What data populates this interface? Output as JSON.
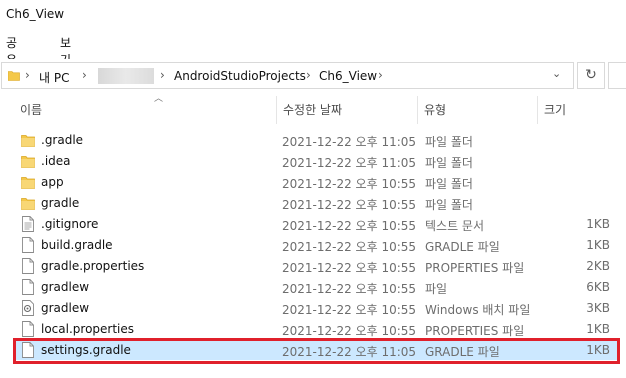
{
  "window": {
    "title": "Ch6_View"
  },
  "ribbon": {
    "share": "공유",
    "view": "보기"
  },
  "address": {
    "this_pc": "내 PC",
    "projects": "AndroidStudioProjects",
    "current": "Ch6_View",
    "refresh_icon": "refresh-icon"
  },
  "columns": {
    "name": "이름",
    "date": "수정한 날짜",
    "type": "유형",
    "size": "크기"
  },
  "files": [
    {
      "name": ".gradle",
      "date": "2021-12-22 오후 11:05",
      "type": "파일 폴더",
      "size": "",
      "icon": "folder"
    },
    {
      "name": ".idea",
      "date": "2021-12-22 오후 11:05",
      "type": "파일 폴더",
      "size": "",
      "icon": "folder"
    },
    {
      "name": "app",
      "date": "2021-12-22 오후 10:55",
      "type": "파일 폴더",
      "size": "",
      "icon": "folder"
    },
    {
      "name": "gradle",
      "date": "2021-12-22 오후 10:55",
      "type": "파일 폴더",
      "size": "",
      "icon": "folder"
    },
    {
      "name": ".gitignore",
      "date": "2021-12-22 오후 10:55",
      "type": "텍스트 문서",
      "size": "1KB",
      "icon": "text"
    },
    {
      "name": "build.gradle",
      "date": "2021-12-22 오후 10:55",
      "type": "GRADLE 파일",
      "size": "1KB",
      "icon": "file"
    },
    {
      "name": "gradle.properties",
      "date": "2021-12-22 오후 10:55",
      "type": "PROPERTIES 파일",
      "size": "2KB",
      "icon": "file"
    },
    {
      "name": "gradlew",
      "date": "2021-12-22 오후 10:55",
      "type": "파일",
      "size": "6KB",
      "icon": "file"
    },
    {
      "name": "gradlew",
      "date": "2021-12-22 오후 10:55",
      "type": "Windows 배치 파일",
      "size": "3KB",
      "icon": "batch"
    },
    {
      "name": "local.properties",
      "date": "2021-12-22 오후 10:55",
      "type": "PROPERTIES 파일",
      "size": "1KB",
      "icon": "file"
    },
    {
      "name": "settings.gradle",
      "date": "2021-12-22 오후 11:05",
      "type": "GRADLE 파일",
      "size": "1KB",
      "icon": "file",
      "selected": true
    }
  ],
  "colors": {
    "folder": "#f4c84a",
    "selection": "#cce8ff",
    "highlight": "#e0202b"
  }
}
